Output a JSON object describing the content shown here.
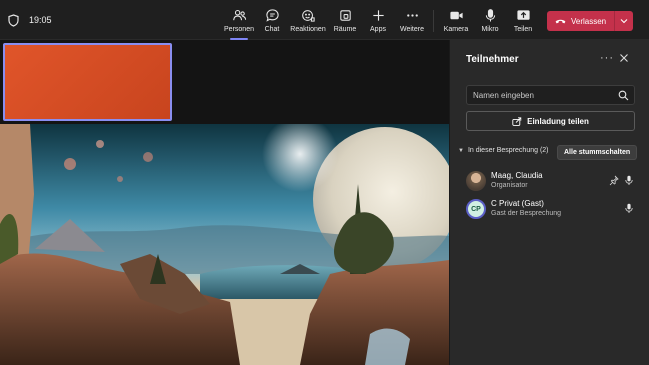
{
  "topbar": {
    "time": "19:05",
    "buttons": [
      {
        "label": "Personen",
        "icon": "people-icon"
      },
      {
        "label": "Chat",
        "icon": "chat-icon"
      },
      {
        "label": "Reaktionen",
        "icon": "reactions-icon"
      },
      {
        "label": "Räume",
        "icon": "rooms-icon"
      },
      {
        "label": "Apps",
        "icon": "add-icon"
      },
      {
        "label": "Weitere",
        "icon": "more-icon"
      },
      {
        "label": "Kamera",
        "icon": "camera-icon"
      },
      {
        "label": "Mikro",
        "icon": "microphone-icon"
      },
      {
        "label": "Teilen",
        "icon": "share-icon"
      }
    ],
    "active": "Personen",
    "leave_label": "Verlassen",
    "leave_color": "#c4314b",
    "accent": "#7f85f5"
  },
  "panel": {
    "title": "Teilnehmer",
    "search_placeholder": "Namen eingeben",
    "invite_label": "Einladung teilen",
    "section_label": "In dieser Besprechung (2)",
    "mute_all_label": "Alle stummschalten",
    "participants": [
      {
        "name": "Maag, Claudia",
        "role": "Organisator",
        "avatar": "photo"
      },
      {
        "name": "C Privat (Gast)",
        "role": "Gast der Besprechung",
        "initials": "CP"
      }
    ]
  },
  "stage": {
    "thumbnail_color": "#d94f25",
    "content": "shared-screen-landscape"
  }
}
